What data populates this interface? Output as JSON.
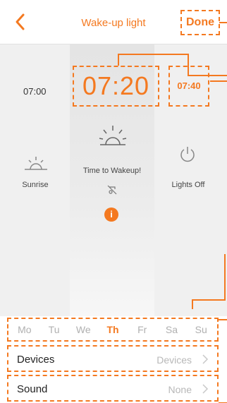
{
  "header": {
    "title": "Wake-up light",
    "done_label": "Done"
  },
  "times": {
    "start": "07:00",
    "wake": "07:20",
    "end": "07:40"
  },
  "phases": {
    "sunrise_label": "Sunrise",
    "wake_label": "Time to Wakeup!",
    "off_label": "Lights Off",
    "info_glyph": "i"
  },
  "days": [
    {
      "label": "Mo",
      "active": false
    },
    {
      "label": "Tu",
      "active": false
    },
    {
      "label": "We",
      "active": false
    },
    {
      "label": "Th",
      "active": true
    },
    {
      "label": "Fr",
      "active": false
    },
    {
      "label": "Sa",
      "active": false
    },
    {
      "label": "Su",
      "active": false
    }
  ],
  "settings": {
    "devices_label": "Devices",
    "devices_value": "Devices",
    "sound_label": "Sound",
    "sound_value": "None"
  },
  "colors": {
    "accent": "#f47920",
    "inactive_day": "#b0b0b0",
    "row_value": "#b8b8b8"
  },
  "icons": {
    "back": "chevron-left-icon",
    "sunrise": "sunrise-icon",
    "sun": "sun-icon",
    "alarm_off": "alarm-off-icon",
    "power": "power-icon",
    "info": "info-icon",
    "chevron": "chevron-right-icon"
  }
}
